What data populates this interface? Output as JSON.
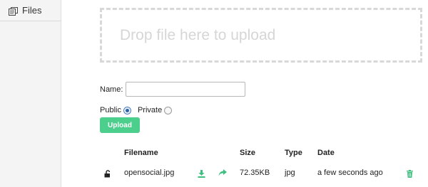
{
  "sidebar": {
    "items": [
      {
        "label": "Files",
        "icon": "files-icon"
      }
    ]
  },
  "dropzone": {
    "text": "Drop file here to upload"
  },
  "form": {
    "name_label": "Name:",
    "name_value": "",
    "visibility": {
      "public_label": "Public",
      "private_label": "Private",
      "selected": "Public"
    },
    "upload_label": "Upload"
  },
  "table": {
    "headers": [
      "Filename",
      "Size",
      "Type",
      "Date"
    ],
    "rows": [
      {
        "lock": "unlocked-icon",
        "filename": "opensocial.jpg",
        "size": "72.35KB",
        "type": "jpg",
        "date": "a few seconds ago",
        "actions": [
          "download-icon",
          "share-icon",
          "trash-icon"
        ]
      }
    ]
  },
  "colors": {
    "accent": "#4ccf8c",
    "sidebar_bg": "#f4f4f4",
    "dropzone_border": "#d8d8d8",
    "dropzone_text": "#d6d6d6"
  }
}
